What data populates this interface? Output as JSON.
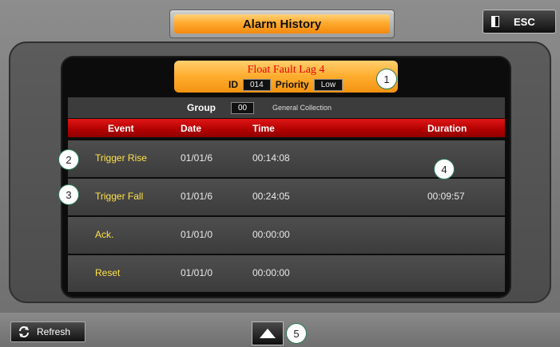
{
  "title": "Alarm History",
  "esc_label": "ESC",
  "alarm": {
    "name": "Float Fault Lag 4",
    "id_label": "ID",
    "id_value": "014",
    "priority_label": "Priority",
    "priority_value": "Low"
  },
  "group": {
    "label": "Group",
    "code": "00",
    "name": "General Collection"
  },
  "columns": [
    "Event",
    "Date",
    "Time",
    "Duration"
  ],
  "rows": [
    {
      "event": "Trigger Rise",
      "date": "01/01/6",
      "time": "00:14:08",
      "duration": ""
    },
    {
      "event": "Trigger Fall",
      "date": "01/01/6",
      "time": "00:24:05",
      "duration": "00:09:57"
    },
    {
      "event": "Ack.",
      "date": "01/01/0",
      "time": "00:00:00",
      "duration": ""
    },
    {
      "event": "Reset",
      "date": "01/01/0",
      "time": "00:00:00",
      "duration": ""
    }
  ],
  "refresh_label": "Refresh",
  "callouts": [
    "1",
    "2",
    "3",
    "4",
    "5"
  ],
  "icons": {
    "esc": "door-exit-icon",
    "refresh": "refresh-arrows-icon",
    "up": "triangle-up-icon"
  },
  "colors": {
    "accent_orange": "#ffac2d",
    "header_red": "#b00000",
    "event_yellow": "#ffe24a",
    "alarm_red": "#e8000a"
  }
}
